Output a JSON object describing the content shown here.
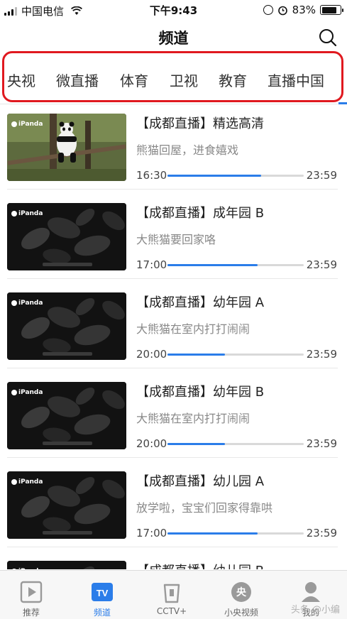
{
  "status_bar": {
    "carrier": "中国电信",
    "time": "下午9:43",
    "battery": "83%",
    "battery_level": 0.83
  },
  "header": {
    "title": "频道",
    "search_icon": "search-icon"
  },
  "tabs": [
    {
      "label": "央视"
    },
    {
      "label": "微直播"
    },
    {
      "label": "体育"
    },
    {
      "label": "卫视"
    },
    {
      "label": "教育"
    },
    {
      "label": "直播中国"
    }
  ],
  "programs": [
    {
      "title": "【成都直播】精选高清",
      "desc": "熊猫回屋，进食嬉戏",
      "start": "16:30",
      "end": "23:59",
      "progress": 0.69,
      "thumb": "panda-in-tree"
    },
    {
      "title": "【成都直播】成年园 B",
      "desc": "大熊猫要回家咯",
      "start": "17:00",
      "end": "23:59",
      "progress": 0.66,
      "thumb": "night-foliage"
    },
    {
      "title": "【成都直播】幼年园 A",
      "desc": "大熊猫在室内打打闹闹",
      "start": "20:00",
      "end": "23:59",
      "progress": 0.42,
      "thumb": "night-foliage"
    },
    {
      "title": "【成都直播】幼年园 B",
      "desc": "大熊猫在室内打打闹闹",
      "start": "20:00",
      "end": "23:59",
      "progress": 0.42,
      "thumb": "night-foliage"
    },
    {
      "title": "【成都直播】幼儿园 A",
      "desc": "放学啦，宝宝们回家得靠哄",
      "start": "17:00",
      "end": "23:59",
      "progress": 0.66,
      "thumb": "night-foliage"
    },
    {
      "title": "【成都直播】幼儿园 B",
      "desc": "",
      "start": "",
      "end": "",
      "progress": 0,
      "thumb": "night-foliage"
    }
  ],
  "thumb_logo": "iPanda",
  "bottom_nav": [
    {
      "label": "推荐",
      "icon": "play-icon",
      "active": false
    },
    {
      "label": "频道",
      "icon": "tv-icon",
      "active": true
    },
    {
      "label": "CCTV+",
      "icon": "cctv-plus-icon",
      "active": false
    },
    {
      "label": "小央视频",
      "icon": "yang-icon",
      "active": false
    },
    {
      "label": "我的",
      "icon": "profile-icon",
      "active": false
    }
  ],
  "watermark": "头条 @小编",
  "colors": {
    "accent": "#2b7de9",
    "highlight_border": "#e0191f",
    "progress_track": "#d9d9d9"
  }
}
